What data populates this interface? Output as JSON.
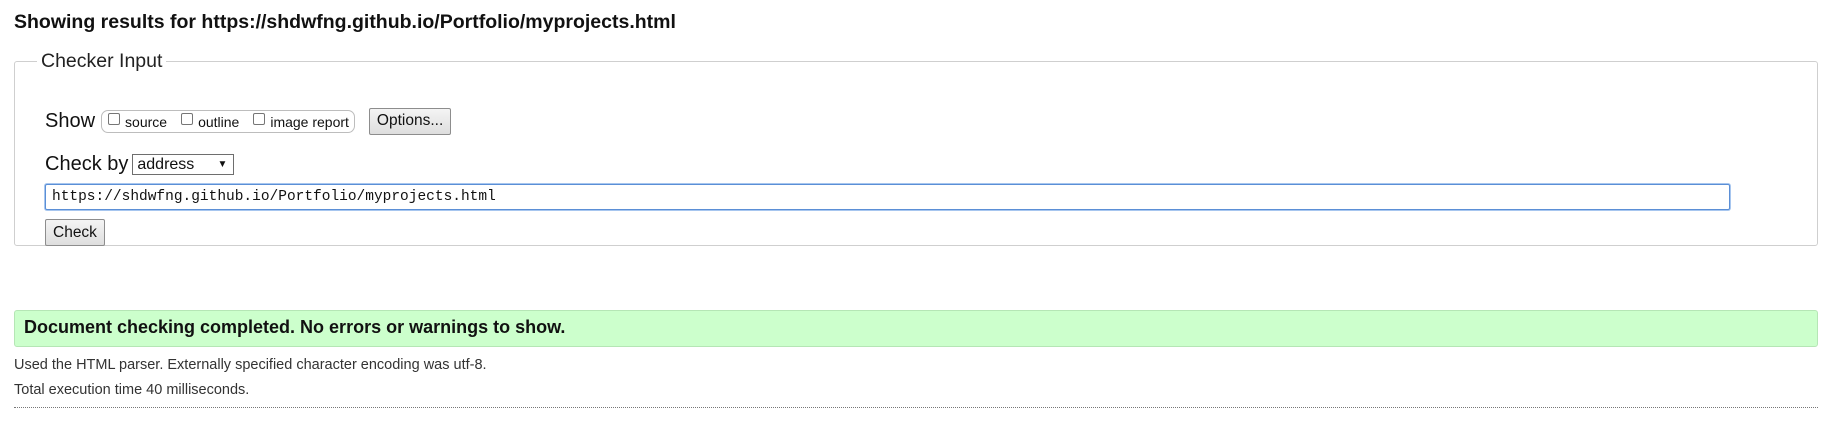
{
  "header": {
    "title": "Showing results for https://shdwfng.github.io/Portfolio/myprojects.html"
  },
  "checker_input": {
    "legend": "Checker Input",
    "show_label": "Show",
    "show_options": [
      {
        "label": "source",
        "checked": false
      },
      {
        "label": "outline",
        "checked": false
      },
      {
        "label": "image report",
        "checked": false
      }
    ],
    "options_button": "Options...",
    "check_by_label": "Check by",
    "check_by_selected": "address",
    "url_value": "https://shdwfng.github.io/Portfolio/myprojects.html",
    "check_button": "Check"
  },
  "result": {
    "banner": "Document checking completed. No errors or warnings to show.",
    "banner_color": "#ccffcc",
    "parser_info": "Used the HTML parser. Externally specified character encoding was utf-8.",
    "execution_time": "Total execution time 40 milliseconds."
  }
}
